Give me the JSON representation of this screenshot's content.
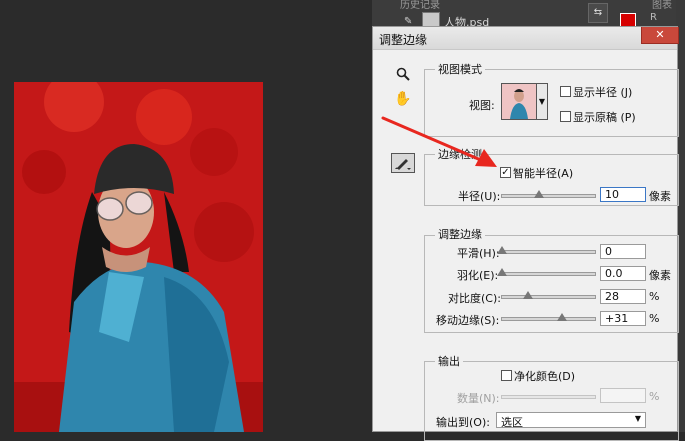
{
  "history_panel": {
    "tab_history": "历史记录",
    "tab_other": "图表",
    "file_name": "人物.psd",
    "r_label": "R"
  },
  "dialog": {
    "title": "调整边缘",
    "close": "✕",
    "view_mode": {
      "title": "视图模式",
      "view_label": "视图:",
      "show_radius": "显示半径 (J)",
      "show_original": "显示原稿 (P)"
    },
    "edge_detection": {
      "title": "边缘检测",
      "smart_radius": "智能半径(A)",
      "smart_radius_checked": true,
      "radius_label": "半径(U):",
      "radius_value": "10",
      "radius_unit": "像素",
      "radius_slider_fraction": 0.35
    },
    "adjust_edge": {
      "title": "调整边缘",
      "smooth_label": "平滑(H):",
      "smooth_value": "0",
      "feather_label": "羽化(E):",
      "feather_value": "0.0",
      "feather_unit": "像素",
      "contrast_label": "对比度(C):",
      "contrast_value": "28",
      "contrast_unit": "%",
      "shift_label": "移动边缘(S):",
      "shift_value": "+31",
      "shift_unit": "%"
    },
    "output": {
      "title": "输出",
      "decontaminate": "净化颜色(D)",
      "amount_label": "数量(N):",
      "amount_value": "",
      "amount_unit": "%",
      "output_to_label": "输出到(O):",
      "output_to_value": "选区"
    }
  },
  "colors": {
    "annotation_arrow": "#e8271f",
    "photo_red": "#c41818",
    "jacket_blue": "#2f86ad"
  },
  "icons": [
    "zoom-icon",
    "hand-icon",
    "refine-radius-brush-icon",
    "chevron-down-icon",
    "close-icon"
  ]
}
